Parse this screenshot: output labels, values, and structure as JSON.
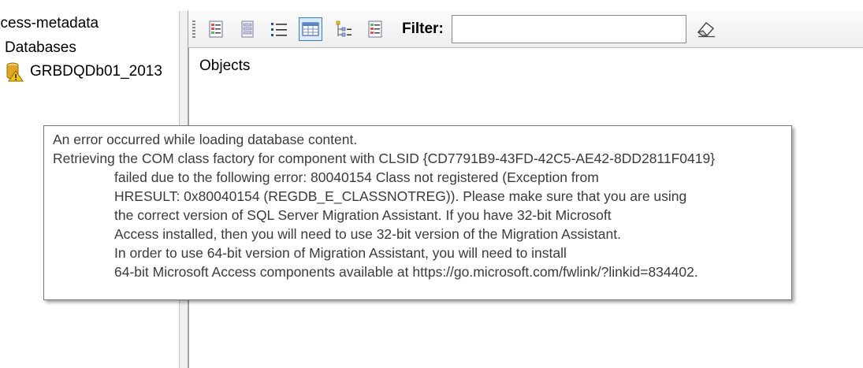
{
  "tree": {
    "root_label": "ccess-metadata",
    "group_label": "Databases",
    "database_label": "GRBDQDb01_2013"
  },
  "toolbar": {
    "buttons": [
      {
        "icon": "checklist-icon"
      },
      {
        "icon": "list-detail-icon"
      },
      {
        "icon": "bulleted-list-icon"
      },
      {
        "icon": "grid-view-icon"
      },
      {
        "icon": "sort-icon"
      },
      {
        "icon": "report-icon"
      }
    ],
    "filter_label": "Filter:",
    "filter_value": "",
    "clear_icon": "eraser-icon"
  },
  "objects_header": "Objects",
  "error_tooltip": {
    "lines": [
      "An error occurred while loading database content.",
      "Retrieving the COM class factory for component with CLSID {CD7791B9-43FD-42C5-AE42-8DD2811F0419}",
      "failed due to the following error: 80040154 Class not registered (Exception from",
      "HRESULT: 0x80040154 (REGDB_E_CLASSNOTREG)). Please make sure that you are using",
      "the correct version of SQL Server Migration Assistant. If you have 32-bit Microsoft",
      "Access installed, then you will need to use 32-bit version of the Migration Assistant.",
      "In order to use 64-bit version of Migration Assistant, you will need to install",
      "64-bit Microsoft Access components available at https://go.microsoft.com/fwlink/?linkid=834402."
    ]
  },
  "colors": {
    "toolbar_active_bg": "#dbe9f9",
    "toolbar_active_border": "#3c7fb1",
    "warning_yellow": "#f4c20d",
    "db_gold": "#e0a526"
  }
}
